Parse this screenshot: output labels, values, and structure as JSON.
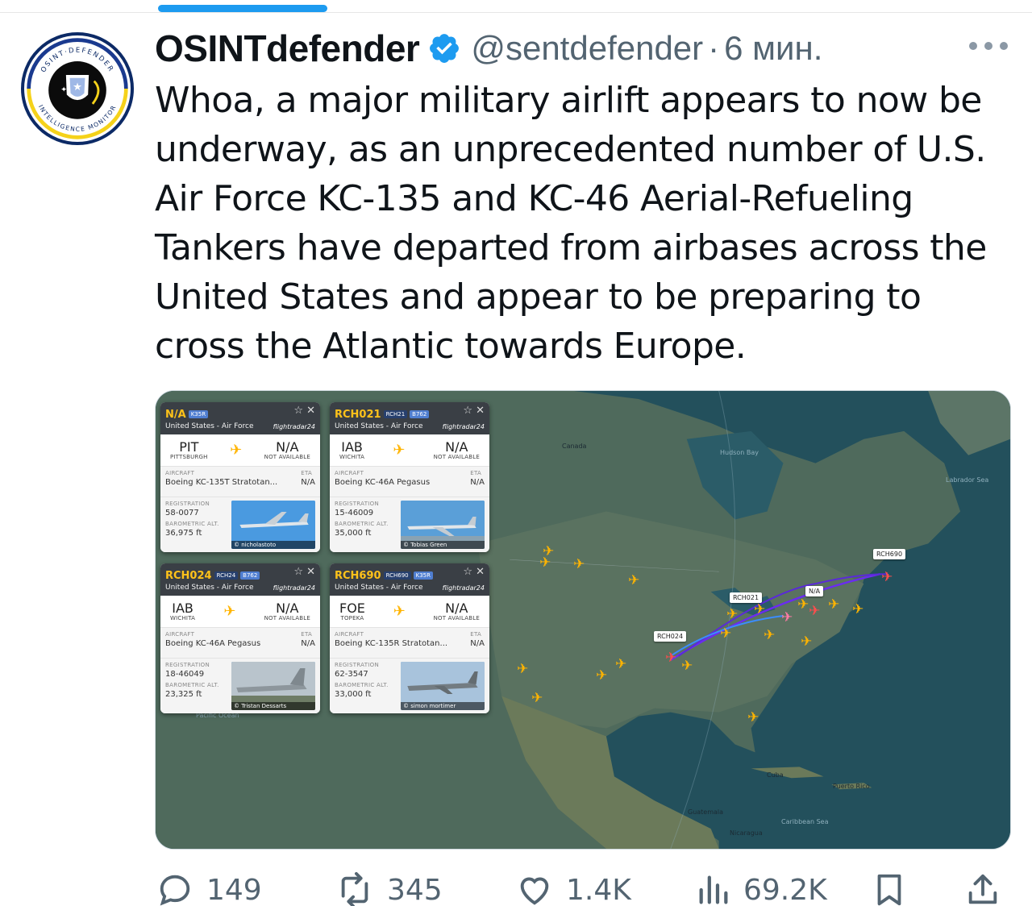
{
  "tweet": {
    "display_name": "OSINTdefender",
    "handle": "@sentdefender",
    "separator": "·",
    "time": "6 мин.",
    "text": "Whoa, a major military airlift appears to now be underway, as an unprecedented number of U.S. Air Force KC-135 and KC-46 Aerial-Refueling Tankers have departed from airbases across the United States and appear to be preparing to cross the Atlantic towards Europe."
  },
  "avatar": {
    "ring_top": "OSINT·DEFENDER",
    "ring_bottom": "INTELLIGENCE MONITOR"
  },
  "actions": {
    "replies": "149",
    "reposts": "345",
    "likes": "1.4K",
    "views": "69.2K"
  },
  "cards": [
    {
      "callsign": "N/A",
      "tags": [
        "K35R"
      ],
      "operator": "United States - Air Force",
      "brand": "flightradar24",
      "from_code": "PIT",
      "from_city": "PITTSBURGH",
      "to_code": "N/A",
      "to_city": "NOT AVAILABLE",
      "aircraft_label": "AIRCRAFT",
      "aircraft": "Boeing KC-135T Stratotan...",
      "eta_label": "ETA",
      "eta": "N/A",
      "registration_label": "REGISTRATION",
      "registration": "58-0077",
      "alt_label": "BAROMETRIC ALT.",
      "altitude": "36,975 ft",
      "photo_credit": "© nicholastoto"
    },
    {
      "callsign": "RCH021",
      "tags": [
        "RCH21",
        "B762"
      ],
      "operator": "United States - Air Force",
      "brand": "flightradar24",
      "from_code": "IAB",
      "from_city": "WICHITA",
      "to_code": "N/A",
      "to_city": "NOT AVAILABLE",
      "aircraft_label": "AIRCRAFT",
      "aircraft": "Boeing KC-46A Pegasus",
      "eta_label": "ETA",
      "eta": "N/A",
      "registration_label": "REGISTRATION",
      "registration": "15-46009",
      "alt_label": "BAROMETRIC ALT.",
      "altitude": "35,000 ft",
      "photo_credit": "© Tobias Green"
    },
    {
      "callsign": "RCH024",
      "tags": [
        "RCH24",
        "B762"
      ],
      "operator": "United States - Air Force",
      "brand": "flightradar24",
      "from_code": "IAB",
      "from_city": "WICHITA",
      "to_code": "N/A",
      "to_city": "NOT AVAILABLE",
      "aircraft_label": "AIRCRAFT",
      "aircraft": "Boeing KC-46A Pegasus",
      "eta_label": "ETA",
      "eta": "N/A",
      "registration_label": "REGISTRATION",
      "registration": "18-46049",
      "alt_label": "BAROMETRIC ALT.",
      "altitude": "23,325 ft",
      "photo_credit": "© Tristan Dessarts"
    },
    {
      "callsign": "RCH690",
      "tags": [
        "RCH690",
        "K35R"
      ],
      "operator": "United States - Air Force",
      "brand": "flightradar24",
      "from_code": "FOE",
      "from_city": "TOPEKA",
      "to_code": "N/A",
      "to_city": "NOT AVAILABLE",
      "aircraft_label": "AIRCRAFT",
      "aircraft": "Boeing KC-135R Stratotan...",
      "eta_label": "ETA",
      "eta": "N/A",
      "registration_label": "REGISTRATION",
      "registration": "62-3547",
      "alt_label": "BAROMETRIC ALT.",
      "altitude": "33,000 ft",
      "photo_credit": "© simon mortimer"
    }
  ],
  "map": {
    "labels": {
      "canada": "Canada",
      "hudson_bay": "Hudson Bay",
      "labrador_sea": "Labrador Sea",
      "pacific_ocean": "Pacific Ocean",
      "cuba": "Cuba",
      "puerto_rico": "Puerto Rico",
      "caribbean_sea": "Caribbean Sea",
      "guatemala": "Guatemala",
      "nicaragua": "Nicaragua"
    },
    "flight_tags": {
      "rch690": "RCH690",
      "rch021": "RCH021",
      "na": "N/A",
      "rch024": "RCH024"
    }
  },
  "colors": {
    "accent": "#1d9bf0",
    "tanker_icon": "#ffb400",
    "track": "#6a2cf0"
  }
}
